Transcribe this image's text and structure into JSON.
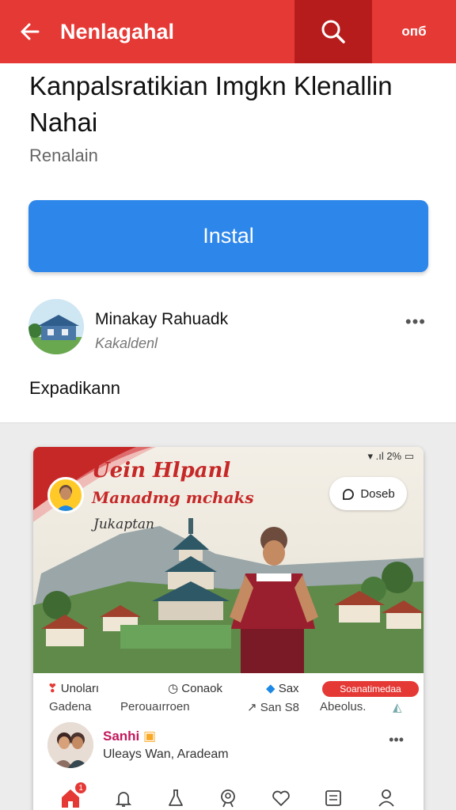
{
  "appbar": {
    "title": "Nenlagahal",
    "extra": "опб"
  },
  "app": {
    "title": "Kanpalsratikian Imgkn Klenallin Nahai",
    "developer": "Renalain",
    "install_label": "Instal"
  },
  "review": {
    "name": "Minakay Rahuadk",
    "subtitle": "Kakaldenl",
    "more": "•••"
  },
  "expand_label": "Expadikann",
  "screenshot": {
    "status": "▾ .ıl 2% ▭",
    "promo_line1": "Uein Hlpanl",
    "promo_line2": "Manadmg mchaks",
    "promo_line3": "Jukaptan",
    "save_label": "Doseb",
    "meta1": {
      "a": "Unoları",
      "b": "Conaok",
      "c": "Sax",
      "chip": "Soanatimedaa"
    },
    "meta2": {
      "a": "Gadena",
      "b": "Perouaırroen",
      "c": "San S8",
      "d": "Abeolus."
    },
    "post": {
      "name": "Sanhi",
      "subtitle": "Uleays Wan, Aradeam",
      "more": "•••"
    },
    "nav_badge": "1"
  },
  "colors": {
    "accent_red": "#e53935",
    "install_blue": "#2d86ea"
  }
}
